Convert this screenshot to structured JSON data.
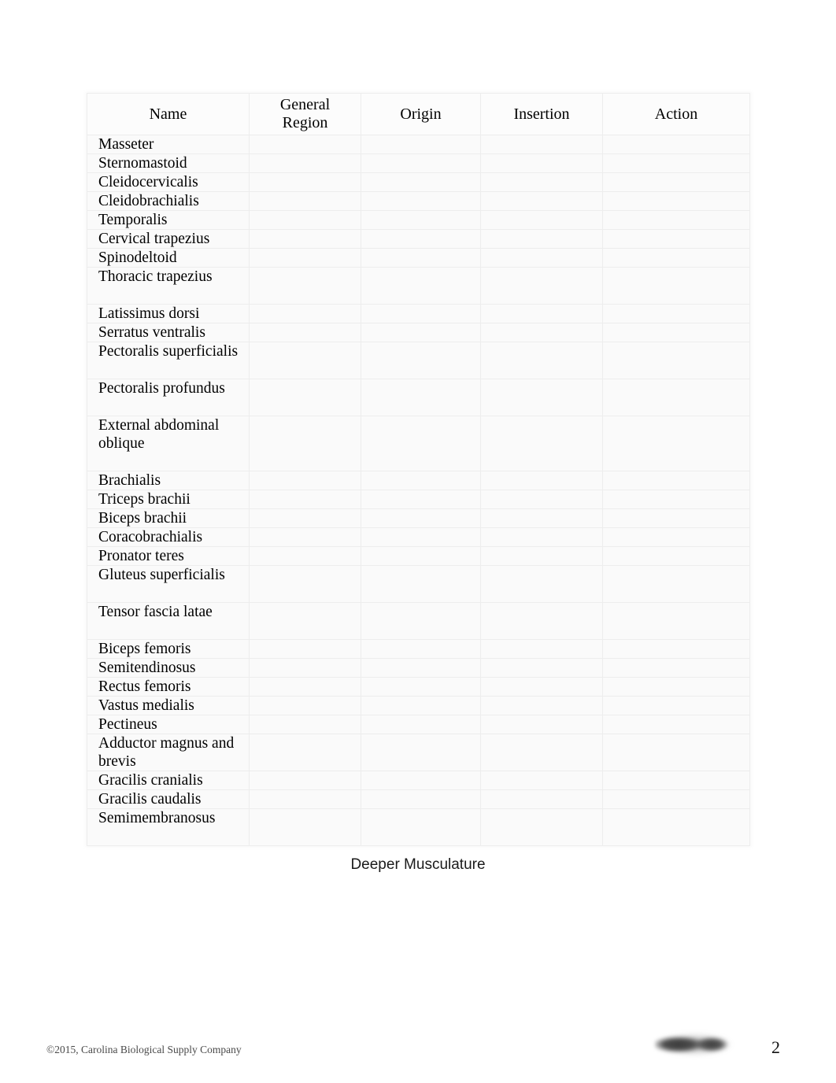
{
  "document": {
    "page_number": "2",
    "caption": "Deeper Musculature",
    "copyright": "©2015, Carolina Biological Supply Company",
    "logo": "publisher-logo-redacted"
  },
  "table": {
    "headers": {
      "name": "Name",
      "general_region_line1": "General",
      "general_region_line2": "Region",
      "origin": "Origin",
      "insertion": "Insertion",
      "action": "Action"
    },
    "rows": [
      {
        "name": "Masseter",
        "general_region": "",
        "origin": "",
        "insertion": "",
        "action": "",
        "lines": 1
      },
      {
        "name": "Sternomastoid",
        "general_region": "",
        "origin": "",
        "insertion": "",
        "action": "",
        "lines": 1
      },
      {
        "name": "Cleidocervicalis",
        "general_region": "",
        "origin": "",
        "insertion": "",
        "action": "",
        "lines": 1
      },
      {
        "name": "Cleidobrachialis",
        "general_region": "",
        "origin": "",
        "insertion": "",
        "action": "",
        "lines": 1
      },
      {
        "name": "Temporalis",
        "general_region": "",
        "origin": "",
        "insertion": "",
        "action": "",
        "lines": 1
      },
      {
        "name": "Cervical trapezius",
        "general_region": "",
        "origin": "",
        "insertion": "",
        "action": "",
        "lines": 1
      },
      {
        "name": "Spinodeltoid",
        "general_region": "",
        "origin": "",
        "insertion": "",
        "action": "",
        "lines": 1
      },
      {
        "name": "Thoracic trapezius",
        "general_region": "",
        "origin": "",
        "insertion": "",
        "action": "",
        "lines": 2
      },
      {
        "name": "Latissimus dorsi",
        "general_region": "",
        "origin": "",
        "insertion": "",
        "action": "",
        "lines": 1
      },
      {
        "name": "Serratus ventralis",
        "general_region": "",
        "origin": "",
        "insertion": "",
        "action": "",
        "lines": 1
      },
      {
        "name": "Pectoralis superficialis",
        "general_region": "",
        "origin": "",
        "insertion": "",
        "action": "",
        "lines": 2
      },
      {
        "name": "Pectoralis profundus",
        "general_region": "",
        "origin": "",
        "insertion": "",
        "action": "",
        "lines": 2
      },
      {
        "name": "External abdominal oblique",
        "general_region": "",
        "origin": "",
        "insertion": "",
        "action": "",
        "lines": 3
      },
      {
        "name": "Brachialis",
        "general_region": "",
        "origin": "",
        "insertion": "",
        "action": "",
        "lines": 1
      },
      {
        "name": "Triceps brachii",
        "general_region": "",
        "origin": "",
        "insertion": "",
        "action": "",
        "lines": 1
      },
      {
        "name": "Biceps brachii",
        "general_region": "",
        "origin": "",
        "insertion": "",
        "action": "",
        "lines": 1
      },
      {
        "name": "Coracobrachialis",
        "general_region": "",
        "origin": "",
        "insertion": "",
        "action": "",
        "lines": 1
      },
      {
        "name": "Pronator teres",
        "general_region": "",
        "origin": "",
        "insertion": "",
        "action": "",
        "lines": 1
      },
      {
        "name": "Gluteus superficialis",
        "general_region": "",
        "origin": "",
        "insertion": "",
        "action": "",
        "lines": 2
      },
      {
        "name": "Tensor fascia latae",
        "general_region": "",
        "origin": "",
        "insertion": "",
        "action": "",
        "lines": 2
      },
      {
        "name": "Biceps femoris",
        "general_region": "",
        "origin": "",
        "insertion": "",
        "action": "",
        "lines": 1
      },
      {
        "name": "Semitendinosus",
        "general_region": "",
        "origin": "",
        "insertion": "",
        "action": "",
        "lines": 1
      },
      {
        "name": "Rectus femoris",
        "general_region": "",
        "origin": "",
        "insertion": "",
        "action": "",
        "lines": 1
      },
      {
        "name": "Vastus medialis",
        "general_region": "",
        "origin": "",
        "insertion": "",
        "action": "",
        "lines": 1
      },
      {
        "name": "Pectineus",
        "general_region": "",
        "origin": "",
        "insertion": "",
        "action": "",
        "lines": 1
      },
      {
        "name": "Adductor magnus and brevis",
        "general_region": "",
        "origin": "",
        "insertion": "",
        "action": "",
        "lines": 2
      },
      {
        "name": "Gracilis cranialis",
        "general_region": "",
        "origin": "",
        "insertion": "",
        "action": "",
        "lines": 1
      },
      {
        "name": "Gracilis caudalis",
        "general_region": "",
        "origin": "",
        "insertion": "",
        "action": "",
        "lines": 1
      },
      {
        "name": "Semimembranosus",
        "general_region": "",
        "origin": "",
        "insertion": "",
        "action": "",
        "lines": 2
      }
    ]
  },
  "colors": {
    "page_background": "#ffffff",
    "table_background": "#fafafa",
    "gridline": "#ededed",
    "text": "#000000",
    "footer_text": "#4a4a4a"
  }
}
